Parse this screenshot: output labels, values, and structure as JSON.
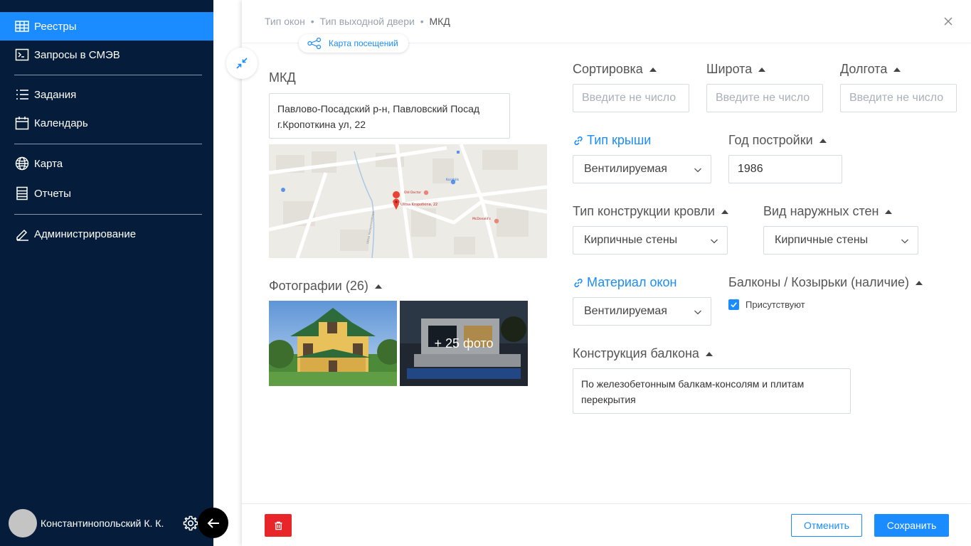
{
  "sidebar": {
    "items": [
      {
        "label": "Реестры",
        "icon": "table-icon",
        "active": true
      },
      {
        "label": "Запросы в СМЭВ",
        "icon": "terminal-icon"
      },
      {
        "label": "Задания",
        "icon": "list-icon"
      },
      {
        "label": "Календарь",
        "icon": "calendar-icon"
      },
      {
        "label": "Карта",
        "icon": "globe-icon"
      },
      {
        "label": "Отчеты",
        "icon": "report-icon"
      },
      {
        "label": "Администрирование",
        "icon": "pen-icon"
      }
    ],
    "user_name": "Константинопольский К. К."
  },
  "breadcrumb": {
    "items": [
      "Тип окон",
      "Тип выходной двери"
    ],
    "current": "МКД",
    "separator": "•"
  },
  "visit_map_label": "Карта посещений",
  "mkd": {
    "label": "МКД",
    "address": "Павлово-Посадский р-н, Павловский Посад г.Кропоткина ул, 22"
  },
  "map": {
    "pin_label": "Ulitsa Kropotkina, 22",
    "poi": [
      "Old Doctor",
      "Korablik",
      "McDonald's"
    ],
    "streets": [
      "Ulitsa Vodoprovodnaya"
    ]
  },
  "photos": {
    "label": "Фотографии (26)",
    "more_label": "+ 25 фото"
  },
  "fields": {
    "sort": {
      "label": "Сортировка",
      "placeholder": "Введите не число"
    },
    "lat": {
      "label": "Широта",
      "placeholder": "Введите не число"
    },
    "lon": {
      "label": "Долгота",
      "placeholder": "Введите не число"
    },
    "roof_type": {
      "label": "Тип крыши",
      "value": "Вентилируемая"
    },
    "year_built": {
      "label": "Год постройки",
      "value": "1986"
    },
    "roof_construction": {
      "label": "Тип конструкции кровли",
      "value": "Кирпичные стены"
    },
    "outer_walls": {
      "label": "Вид наружных стен",
      "value": "Кирпичные стены"
    },
    "window_material": {
      "label": "Материал окон",
      "value": "Вентилируемая"
    },
    "balconies": {
      "label": "Балконы / Козырьки (наличие)",
      "checkbox_label": "Присутствуют",
      "checked": true
    },
    "balcony_construction": {
      "label": "Конструкция балкона",
      "value": "По железобетонным балкам-консолям и плитам перекрытия"
    }
  },
  "footer": {
    "cancel_label": "Отменить",
    "save_label": "Сохранить"
  },
  "colors": {
    "sidebar_bg": "#051d3a",
    "accent": "#1a8cff",
    "danger": "#e8262a"
  }
}
